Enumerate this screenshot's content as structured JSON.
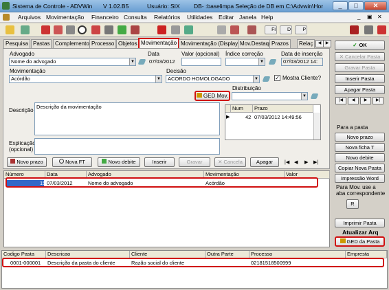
{
  "title": {
    "app": "Sistema de Controle - ADVWin",
    "version": "V 1.02.B5",
    "user": "Usuário: SIX",
    "db": "DB- :baselimpa  Seleção de DB em C:\\Advwin\\Homolog..."
  },
  "menu": [
    "Arquivos",
    "Movimentação",
    "Financeiro",
    "Consulta",
    "Relatórios",
    "Utilidades",
    "Editar",
    "Janela",
    "Help"
  ],
  "toolbar": {
    "fi": "Fi",
    "d": "D",
    "p": "P"
  },
  "tabs": [
    "Pesquisa",
    "Pastas",
    "Complemento",
    "Processo",
    "Objetos",
    "Movimentação",
    "Movimentação (Display)",
    "Mov.Destaque",
    "Prazos",
    "Relaç"
  ],
  "form": {
    "advogado_label": "Advogado",
    "advogado_value": "Nome do advogado",
    "data_label": "Data",
    "data_value": "07/03/2012",
    "valor_label": "Valor (opcional)",
    "indice_label": "Índice correção",
    "data_insercao_label": "Data de inserção",
    "data_insercao_value": "07/03/2012 14:",
    "movimentacao_label": "Movimentação",
    "movimentacao_value": "Acórdão",
    "decisao_label": "Decisão",
    "decisao_value": "ACORDO HOMOLOGADO",
    "mostra_cliente": "Mostra Cliente?",
    "ged_mov": "GED Mov.",
    "distribuicao_label": "Distribuição",
    "descricao_label": "Descrição",
    "descricao_value": "Descrição da movimentação",
    "explicacao_label": "Explicação (opcional)",
    "prazo_headers": [
      "Num",
      "Prazo"
    ],
    "prazo_row": {
      "num": "42",
      "prazo": "07/03/2012 14:49:56"
    }
  },
  "actions": {
    "novo_prazo": "Novo prazo",
    "nova_ft": "Nova FT",
    "novo_debite": "Novo debite",
    "inserir": "Inserir",
    "gravar": "Gravar",
    "cancela": "Cancela",
    "apagar": "Apagar"
  },
  "grid": {
    "headers": [
      "Número",
      "Data",
      "Advogado",
      "Movimentação",
      "Valor"
    ],
    "row": {
      "numero": "15",
      "data": "07/03/2012",
      "advogado": "Nome do advogado",
      "movimentacao": "Acórdão",
      "valor": ""
    }
  },
  "right_panel": {
    "ok": "OK",
    "cancelar_pasta": "Cancelar Pasta",
    "gravar_pasta": "Gravar Pasta",
    "inserir_pasta": "Inserir Pasta",
    "apagar_pasta": "Apagar Pasta",
    "para_a_pasta": "Para a pasta",
    "novo_prazo": "Novo prazo",
    "nova_ficha": "Nova ficha T",
    "novo_debite": "Novo debite",
    "copiar": "Copiar Nova  Pasta",
    "impressao": "Impressão Word",
    "para_mov": "Para Mov. use a aba correspondente",
    "r": "R",
    "imprimir": "Imprimir Pasta",
    "atualizar": "Atualizar Arq",
    "ged_pasta": "GED da Pasta"
  },
  "bottom": {
    "headers": [
      "Codigo Pasta",
      "Descricao",
      "Cliente",
      "Outra Parte",
      "Processo",
      "Empresta"
    ],
    "row": {
      "codigo": "0001-000001",
      "descricao": "Descrição da pasta do cliente",
      "cliente": "Razão social do cliente",
      "outra": "",
      "processo": "02181518500999"
    }
  }
}
